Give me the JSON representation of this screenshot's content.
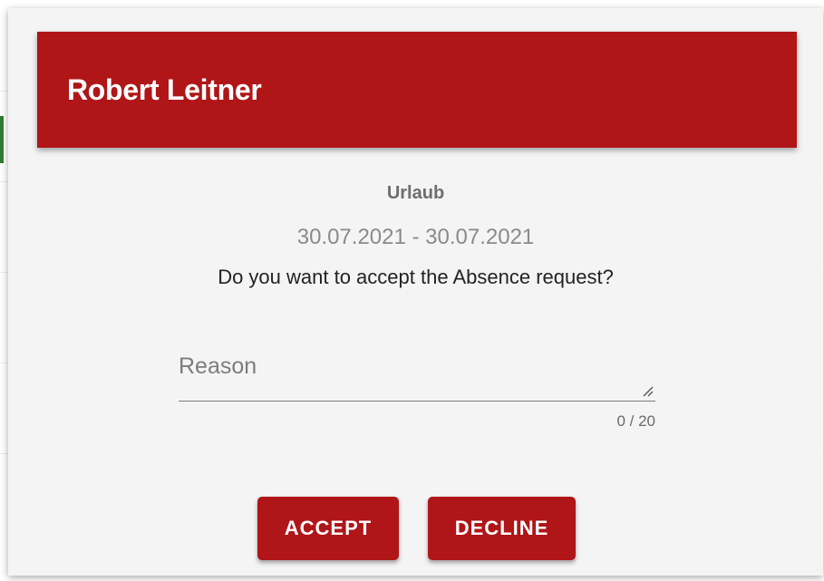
{
  "dialog": {
    "title": "Robert Leitner",
    "absence_type": "Urlaub",
    "date_range": "30.07.2021 - 30.07.2021",
    "question": "Do you want to accept the Absence request?"
  },
  "reason": {
    "placeholder": "Reason",
    "value": "",
    "counter": "0 / 20"
  },
  "actions": {
    "accept_label": "ACCEPT",
    "decline_label": "DECLINE"
  },
  "colors": {
    "primary": "#b01518",
    "dialog_background": "#f4f4f4",
    "header_text": "#ffffff"
  },
  "icons": {
    "resize_handle": "resize-handle-icon"
  }
}
